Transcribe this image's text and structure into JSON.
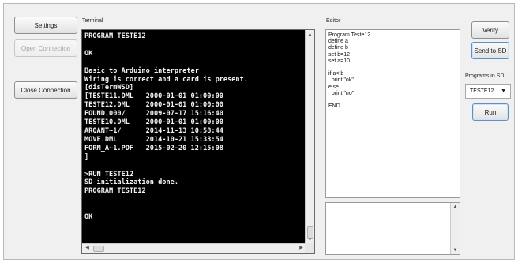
{
  "left_panel": {
    "settings_label": "Settings",
    "open_connection_label": "Open Connection",
    "close_connection_label": "Close Connection"
  },
  "terminal": {
    "label": "Terminal",
    "lines": [
      "PROGRAM TESTE12",
      "",
      "OK",
      "",
      "Basic to Arduino interpreter",
      "Wiring is correct and a card is present.",
      "[disTermWSD]",
      "[TESTE11.DML   2000-01-01 01:00:00",
      "TESTE12.DML    2000-01-01 01:00:00",
      "FOUND.000/     2009-07-17 15:16:40",
      "TESTE10.DML    2000-01-01 01:00:00",
      "ARQANT~1/      2014-11-13 10:58:44",
      "MOVE.DML       2014-10-21 15:33:54",
      "FORM_A~1.PDF   2015-02-20 12:15:08",
      "]",
      "",
      ">RUN TESTE12",
      "SD initialization done.",
      "PROGRAM TESTE12",
      "",
      "",
      "OK"
    ]
  },
  "editor": {
    "label": "Editor",
    "lines": [
      "Program Teste12",
      "define a",
      "define b",
      "set b=12",
      "set a=10",
      "",
      "if a< b",
      "  print \"ok\"",
      "else",
      "  print \"no\"",
      "",
      "END"
    ]
  },
  "right_panel": {
    "verify_label": "Verify",
    "send_to_sd_label": "Send to SD",
    "programs_label": "Programs in SD",
    "selected_program": "TESTE12",
    "run_label": "Run"
  },
  "icons": {
    "dropdown": "chevron-down-icon",
    "scroll_up": "arrow-up-icon",
    "scroll_down": "arrow-down-icon",
    "scroll_left": "arrow-left-icon",
    "scroll_right": "arrow-right-icon"
  },
  "colors": {
    "terminal_bg": "#000000",
    "terminal_fg": "#f2f2f2",
    "window_bg": "#f0f0f0"
  }
}
